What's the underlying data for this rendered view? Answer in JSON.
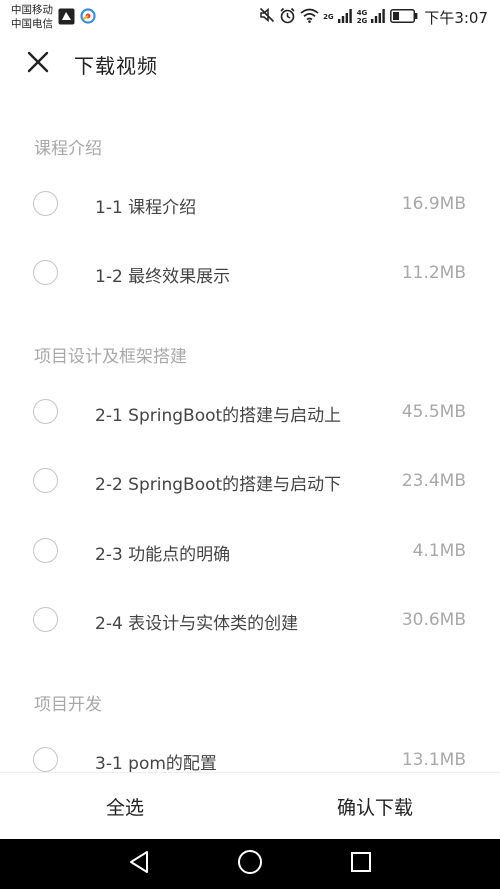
{
  "status_bar": {
    "carrier_1": "中国移动",
    "carrier_2": "中国电信",
    "network_label_1": "2G",
    "network_label_2a": "4G",
    "network_label_2b": "2G",
    "time": "下午3:07"
  },
  "header": {
    "title": "下载视频",
    "close_icon": "close-icon"
  },
  "sections": [
    {
      "title": "课程介绍",
      "items": [
        {
          "label": "1-1 课程介绍",
          "size": "16.9MB",
          "checked": false
        },
        {
          "label": "1-2 最终效果展示",
          "size": "11.2MB",
          "checked": false
        }
      ]
    },
    {
      "title": "项目设计及框架搭建",
      "items": [
        {
          "label": "2-1 SpringBoot的搭建与启动上",
          "size": "45.5MB",
          "checked": false
        },
        {
          "label": "2-2 SpringBoot的搭建与启动下",
          "size": "23.4MB",
          "checked": false
        },
        {
          "label": "2-3 功能点的明确",
          "size": "4.1MB",
          "checked": false
        },
        {
          "label": "2-4 表设计与实体类的创建",
          "size": "30.6MB",
          "checked": false
        }
      ]
    },
    {
      "title": "项目开发",
      "items": [
        {
          "label": "3-1 pom的配置",
          "size": "13.1MB",
          "checked": false
        }
      ]
    }
  ],
  "bottom_bar": {
    "select_all": "全选",
    "confirm_download": "确认下载"
  },
  "nav_bar": {
    "back_icon": "back-triangle-icon",
    "home_icon": "home-circle-icon",
    "recents_icon": "recents-square-icon"
  },
  "colors": {
    "section_title": "#a8a8a8",
    "item_text": "#444444",
    "radio_border": "#c4c4c4",
    "nav_background": "#000000"
  }
}
